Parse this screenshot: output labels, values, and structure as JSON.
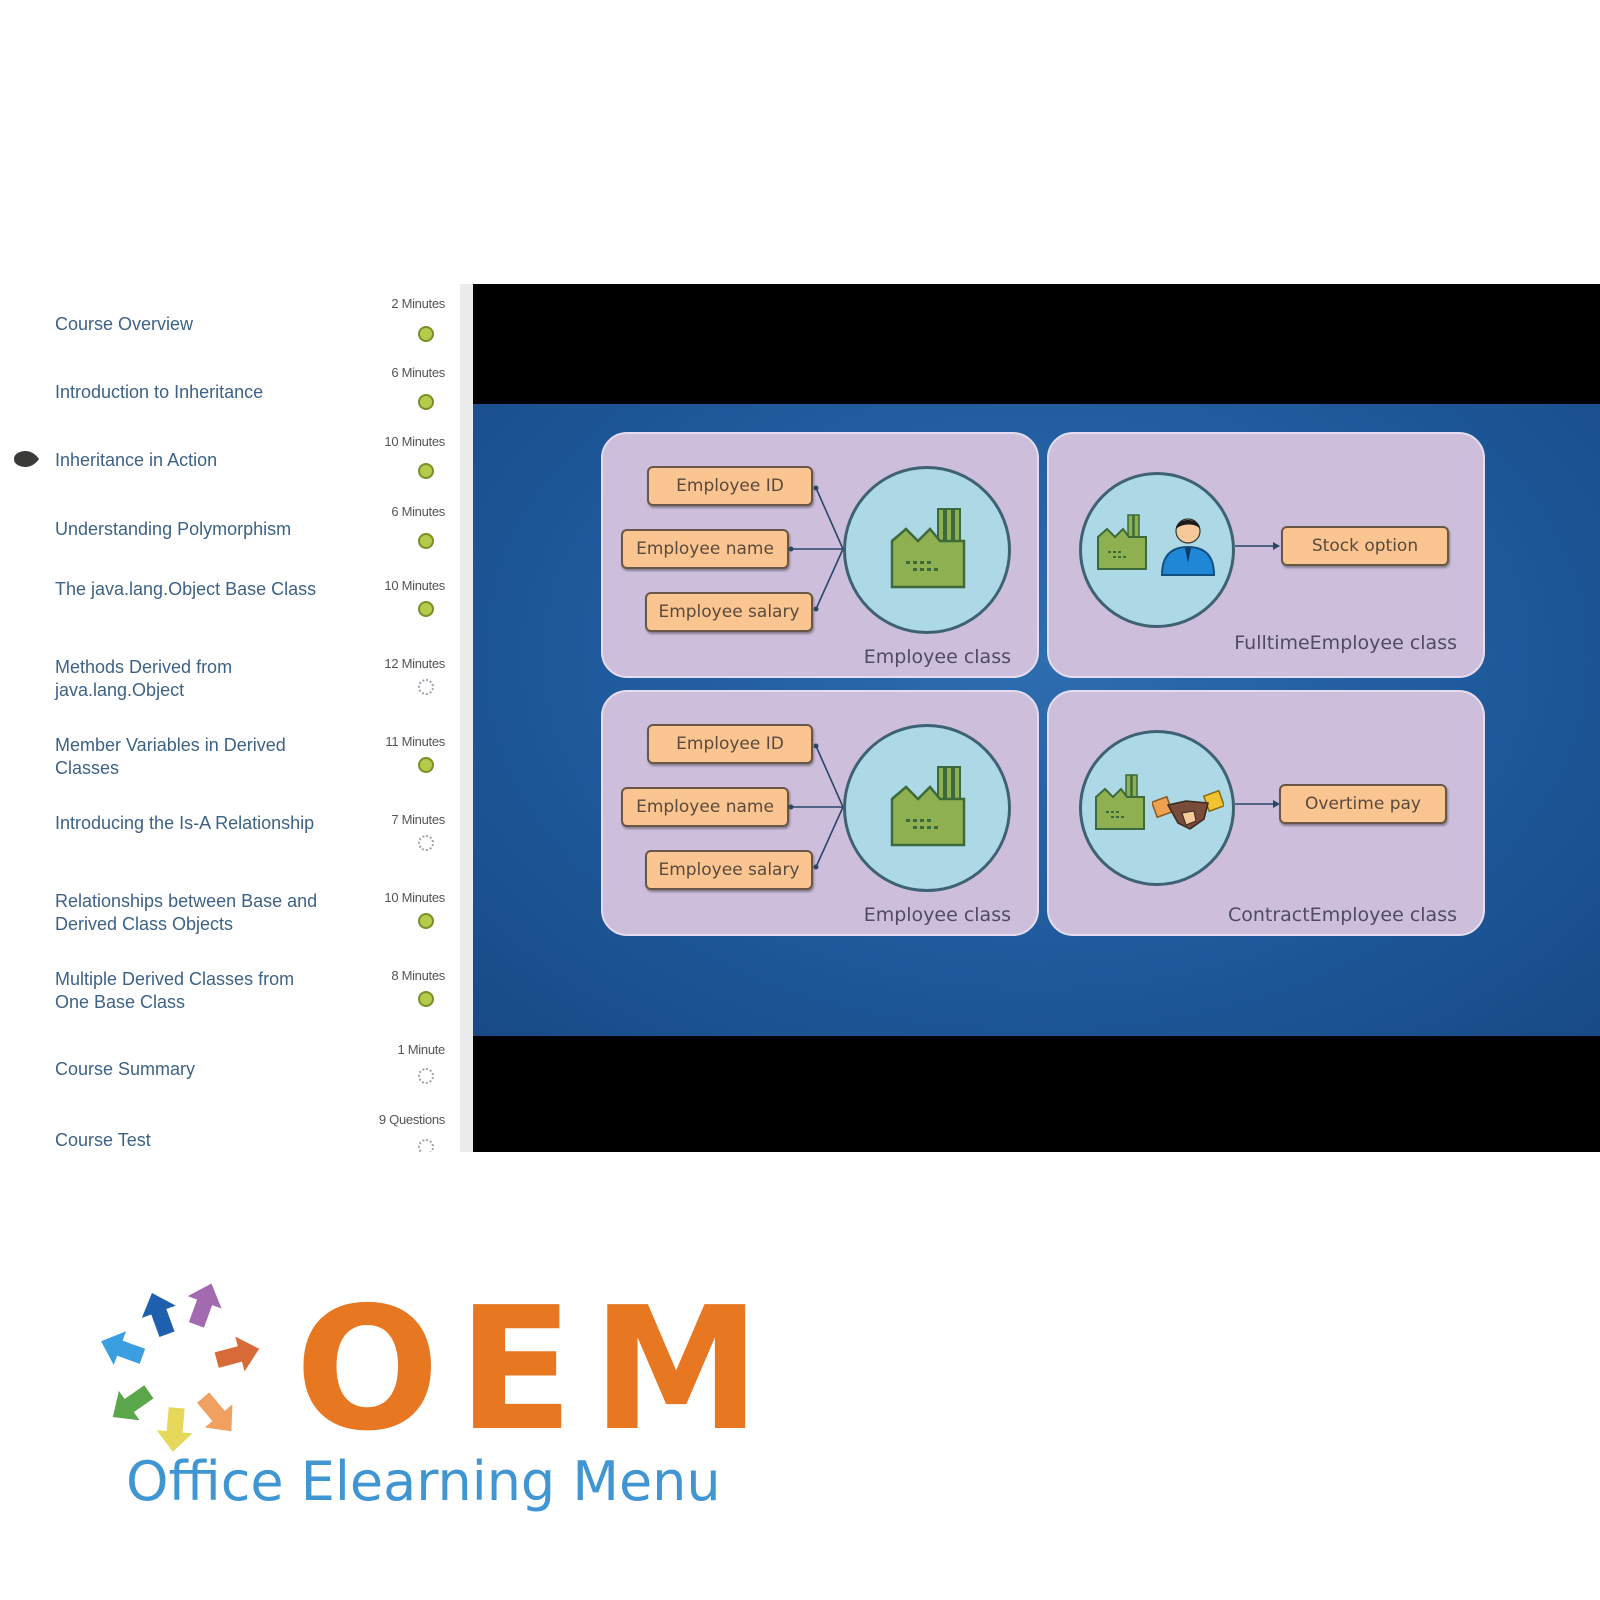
{
  "sidebar": {
    "current_item_index": 2,
    "items": [
      {
        "label": "Course Overview",
        "duration": "2 Minutes",
        "status": "completed"
      },
      {
        "label": "Introduction to Inheritance",
        "duration": "6 Minutes",
        "status": "completed"
      },
      {
        "label": "Inheritance in Action",
        "duration": "10 Minutes",
        "status": "completed"
      },
      {
        "label": "Understanding Polymorphism",
        "duration": "6 Minutes",
        "status": "completed"
      },
      {
        "label": "The java.lang.Object Base Class",
        "duration": "10 Minutes",
        "status": "completed"
      },
      {
        "label": "Methods Derived from java.lang.Object",
        "duration": "12 Minutes",
        "status": "not-started"
      },
      {
        "label": "Member Variables in Derived Classes",
        "duration": "11 Minutes",
        "status": "completed"
      },
      {
        "label": "Introducing the Is-A Relationship",
        "duration": "7 Minutes",
        "status": "not-started"
      },
      {
        "label": "Relationships between Base and Derived Class Objects",
        "duration": "10 Minutes",
        "status": "completed"
      },
      {
        "label": "Multiple Derived Classes from One Base Class",
        "duration": "8 Minutes",
        "status": "completed"
      },
      {
        "label": "Course Summary",
        "duration": "1 Minute",
        "status": "not-started"
      },
      {
        "label": "Course Test",
        "duration": "9 Questions",
        "status": "not-started"
      }
    ]
  },
  "video": {
    "slide": {
      "panels": [
        {
          "class_label": "Employee class",
          "icon": "factory-icon",
          "attributes": [
            "Employee ID",
            "Employee name",
            "Employee salary"
          ]
        },
        {
          "class_label": "FulltimeEmployee class",
          "icon": "factory-person-icon",
          "attributes": [
            "Stock option"
          ]
        },
        {
          "class_label": "Employee class",
          "icon": "factory-icon",
          "attributes": [
            "Employee ID",
            "Employee name",
            "Employee salary"
          ]
        },
        {
          "class_label": "ContractEmployee class",
          "icon": "factory-handshake-icon",
          "attributes": [
            "Overtime pay"
          ]
        }
      ]
    }
  },
  "logo": {
    "brand": "OEM",
    "tagline": "Office Elearning Menu",
    "colors": {
      "brand": "#e87722",
      "tagline": "#3f96d2"
    }
  },
  "colors": {
    "item_text": "#3d6286",
    "status_completed": "#b5cc4a",
    "slide_background": "#1f5a9c",
    "panel_background": "#cdbfdc",
    "attribute_box": "#fbc591",
    "class_circle": "#add8e6"
  }
}
